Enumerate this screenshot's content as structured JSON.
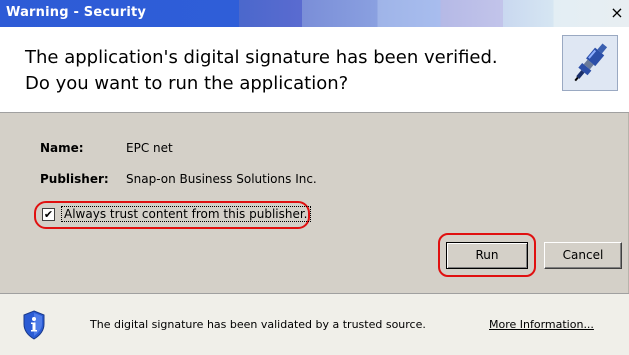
{
  "window": {
    "title": "Warning - Security",
    "close_glyph": "×"
  },
  "header": {
    "line1": "The application's digital signature has been verified.",
    "line2": "Do you want to run the application?",
    "icon": "spark-plug-icon"
  },
  "details": {
    "name_label": "Name:",
    "name_value": "EPC net",
    "publisher_label": "Publisher:",
    "publisher_value": "Snap-on Business Solutions Inc."
  },
  "trust": {
    "checked": true,
    "check_glyph": "✔",
    "label": "Always trust content from this publisher."
  },
  "buttons": {
    "run": "Run",
    "cancel": "Cancel"
  },
  "footer": {
    "icon": "shield-info-icon",
    "message": "The digital signature has been validated by a trusted source.",
    "more_info": "More Information..."
  },
  "colors": {
    "title_bar": "#2d5bd6",
    "highlight_ring": "#e01010",
    "dialog_bg": "#d4d0c8",
    "shield": "#2a5bd4"
  }
}
